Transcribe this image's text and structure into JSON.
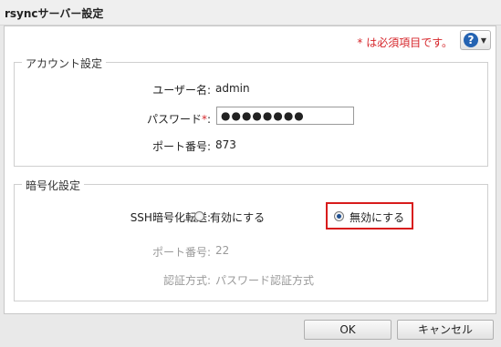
{
  "dialog": {
    "title": "rsyncサーバー設定",
    "required_note": "* は必須項目です。",
    "help_icon_label": "?"
  },
  "account": {
    "legend": "アカウント設定",
    "username_label": "ユーザー名:",
    "username_value": "admin",
    "password_label": "パスワード",
    "password_asterisk": "*",
    "password_colon": ":",
    "password_value": "●●●●●●●●",
    "port_label": "ポート番号:",
    "port_value": "873"
  },
  "encryption": {
    "legend": "暗号化設定",
    "ssh_label": "SSH暗号化転送:",
    "option_enable": "有効にする",
    "option_disable": "無効にする",
    "selected": "無効にする",
    "port_label": "ポート番号:",
    "port_value": "22",
    "auth_label": "認証方式:",
    "auth_value": "パスワード認証方式"
  },
  "footer": {
    "ok_label": "OK",
    "cancel_label": "キャンセル"
  },
  "colors": {
    "required": "#d6262b",
    "highlight": "#d81c1c",
    "help": "#2463b2"
  }
}
